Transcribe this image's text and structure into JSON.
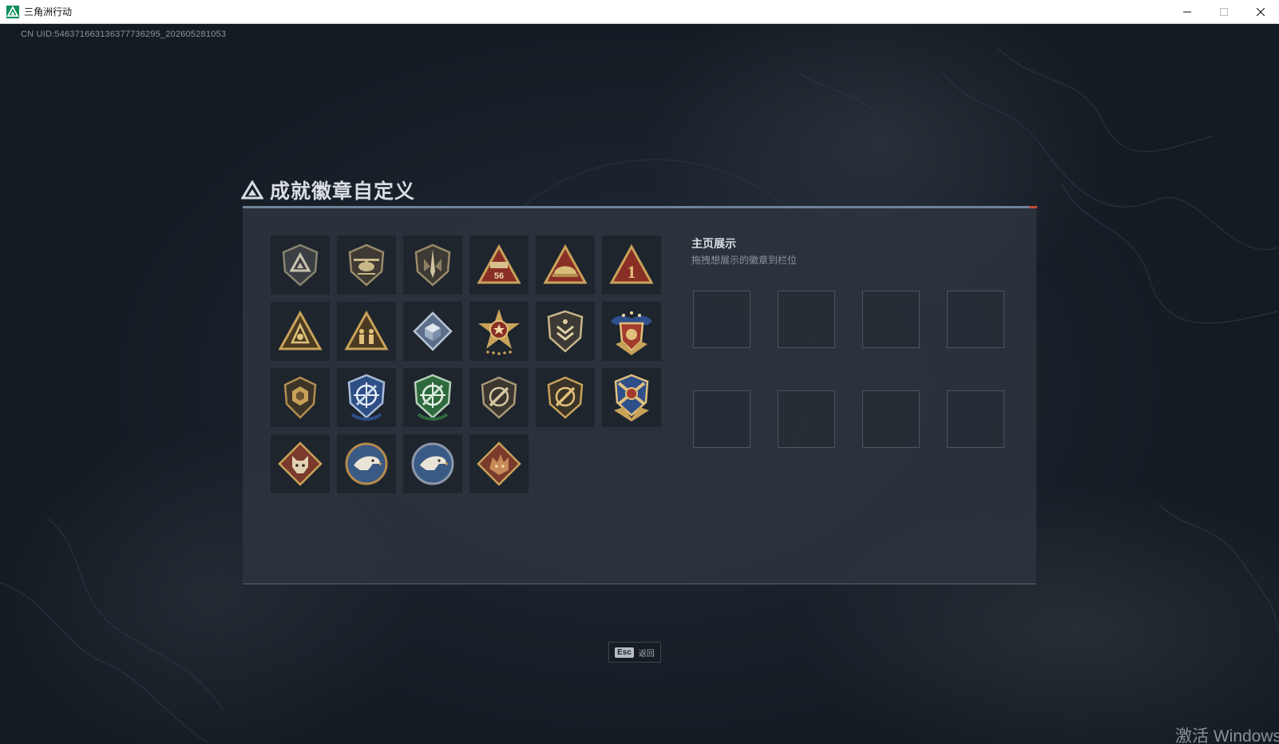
{
  "window": {
    "title": "三角洲行动",
    "controls": [
      "minimize",
      "maximize",
      "close"
    ]
  },
  "uid_text": "CN UID:546371663136377736295_202605281053",
  "panel": {
    "title": "成就徽章自定义",
    "icon": "delta-triangle-logo-icon"
  },
  "badges": [
    {
      "name": "shield-triangle-badge-icon"
    },
    {
      "name": "helicopter-shield-badge-icon"
    },
    {
      "name": "dagger-shield-badge-icon"
    },
    {
      "name": "red-triangle-56-badge-icon"
    },
    {
      "name": "red-triangle-helmet-badge-icon"
    },
    {
      "name": "red-triangle-1-badge-icon"
    },
    {
      "name": "gold-triangle-emblem-badge-icon"
    },
    {
      "name": "gold-triangle-soldiers-badge-icon"
    },
    {
      "name": "silver-diamond-cube-badge-icon"
    },
    {
      "name": "star-medal-badge-icon"
    },
    {
      "name": "chevron-shield-badge-icon"
    },
    {
      "name": "winged-crest-badge-icon"
    },
    {
      "name": "bronze-hex-shield-badge-icon"
    },
    {
      "name": "blue-crosshair-shield-badge-icon"
    },
    {
      "name": "green-crosshair-shield-badge-icon"
    },
    {
      "name": "rifle-shield-badge-icon"
    },
    {
      "name": "rifle-shield-gold-badge-icon"
    },
    {
      "name": "crossed-rifles-crest-badge-icon"
    },
    {
      "name": "wolf-diamond-badge-icon"
    },
    {
      "name": "eagle-circle-badge-icon"
    },
    {
      "name": "eagle-circle-blue-badge-icon"
    },
    {
      "name": "dragon-diamond-badge-icon"
    }
  ],
  "showcase": {
    "title": "主页展示",
    "subtitle": "拖拽想展示的徽章到栏位",
    "slot_count": 8
  },
  "esc_hint": {
    "key": "Esc",
    "label": "返回"
  },
  "watermark": "激活 Windows",
  "colors": {
    "background": "#1a2029",
    "panel": "#2c343e",
    "panel_border_top": "#6f8299",
    "badge_gold": "#c9a25a",
    "badge_red": "#a33a2e",
    "badge_blue": "#3e6aa8",
    "badge_green": "#3f8a4e"
  }
}
